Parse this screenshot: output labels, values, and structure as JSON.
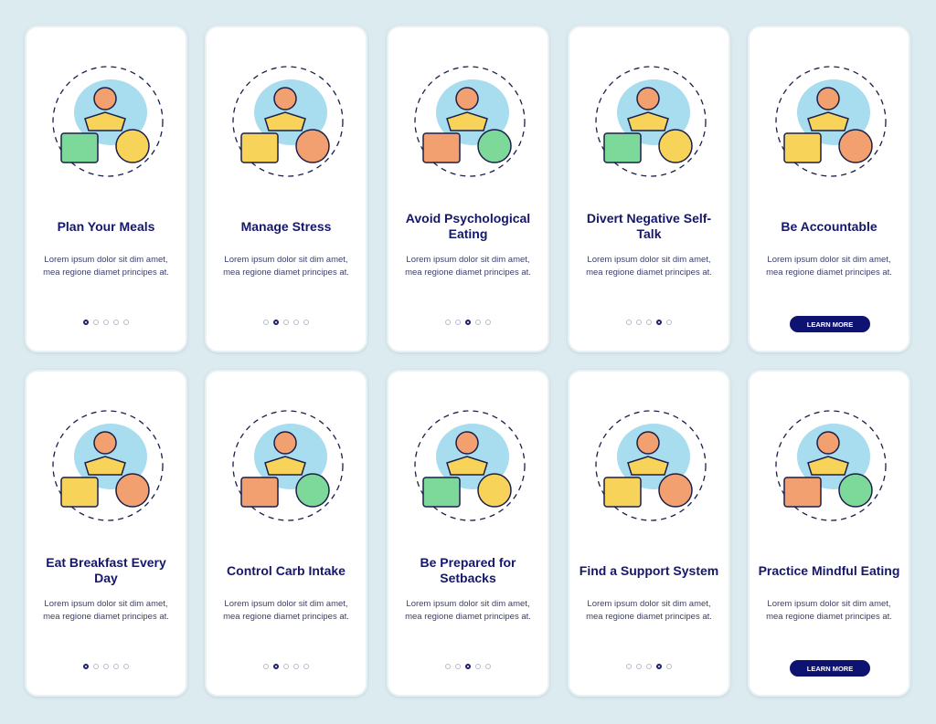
{
  "colors": {
    "background": "#dcebf0",
    "card": "#ffffff",
    "title": "#14176b",
    "button": "#0e1270",
    "blob": "#a8dcef",
    "green": "#7dd99a",
    "yellow": "#f7d35a",
    "orange": "#f2a070"
  },
  "body_text": "Lorem ipsum dolor sit dim amet, mea regione diamet principes at.",
  "button_label": "LEARN MORE",
  "rows": [
    [
      {
        "title": "Plan Your Meals",
        "icon": "meal-planning-illustration",
        "active_dot": 0
      },
      {
        "title": "Manage Stress",
        "icon": "stress-management-illustration",
        "active_dot": 1
      },
      {
        "title": "Avoid Psychological Eating",
        "icon": "psychological-eating-illustration",
        "active_dot": 2
      },
      {
        "title": "Divert Negative Self-Talk",
        "icon": "negative-self-talk-illustration",
        "active_dot": 3
      },
      {
        "title": "Be Accountable",
        "icon": "accountability-illustration",
        "button": true
      }
    ],
    [
      {
        "title": "Eat Breakfast Every Day",
        "icon": "breakfast-illustration",
        "active_dot": 0
      },
      {
        "title": "Control Carb Intake",
        "icon": "carb-control-illustration",
        "active_dot": 1
      },
      {
        "title": "Be Prepared for Setbacks",
        "icon": "setbacks-illustration",
        "active_dot": 2
      },
      {
        "title": "Find a Support System",
        "icon": "support-system-illustration",
        "active_dot": 3
      },
      {
        "title": "Practice Mindful Eating",
        "icon": "mindful-eating-illustration",
        "button": true
      }
    ]
  ]
}
